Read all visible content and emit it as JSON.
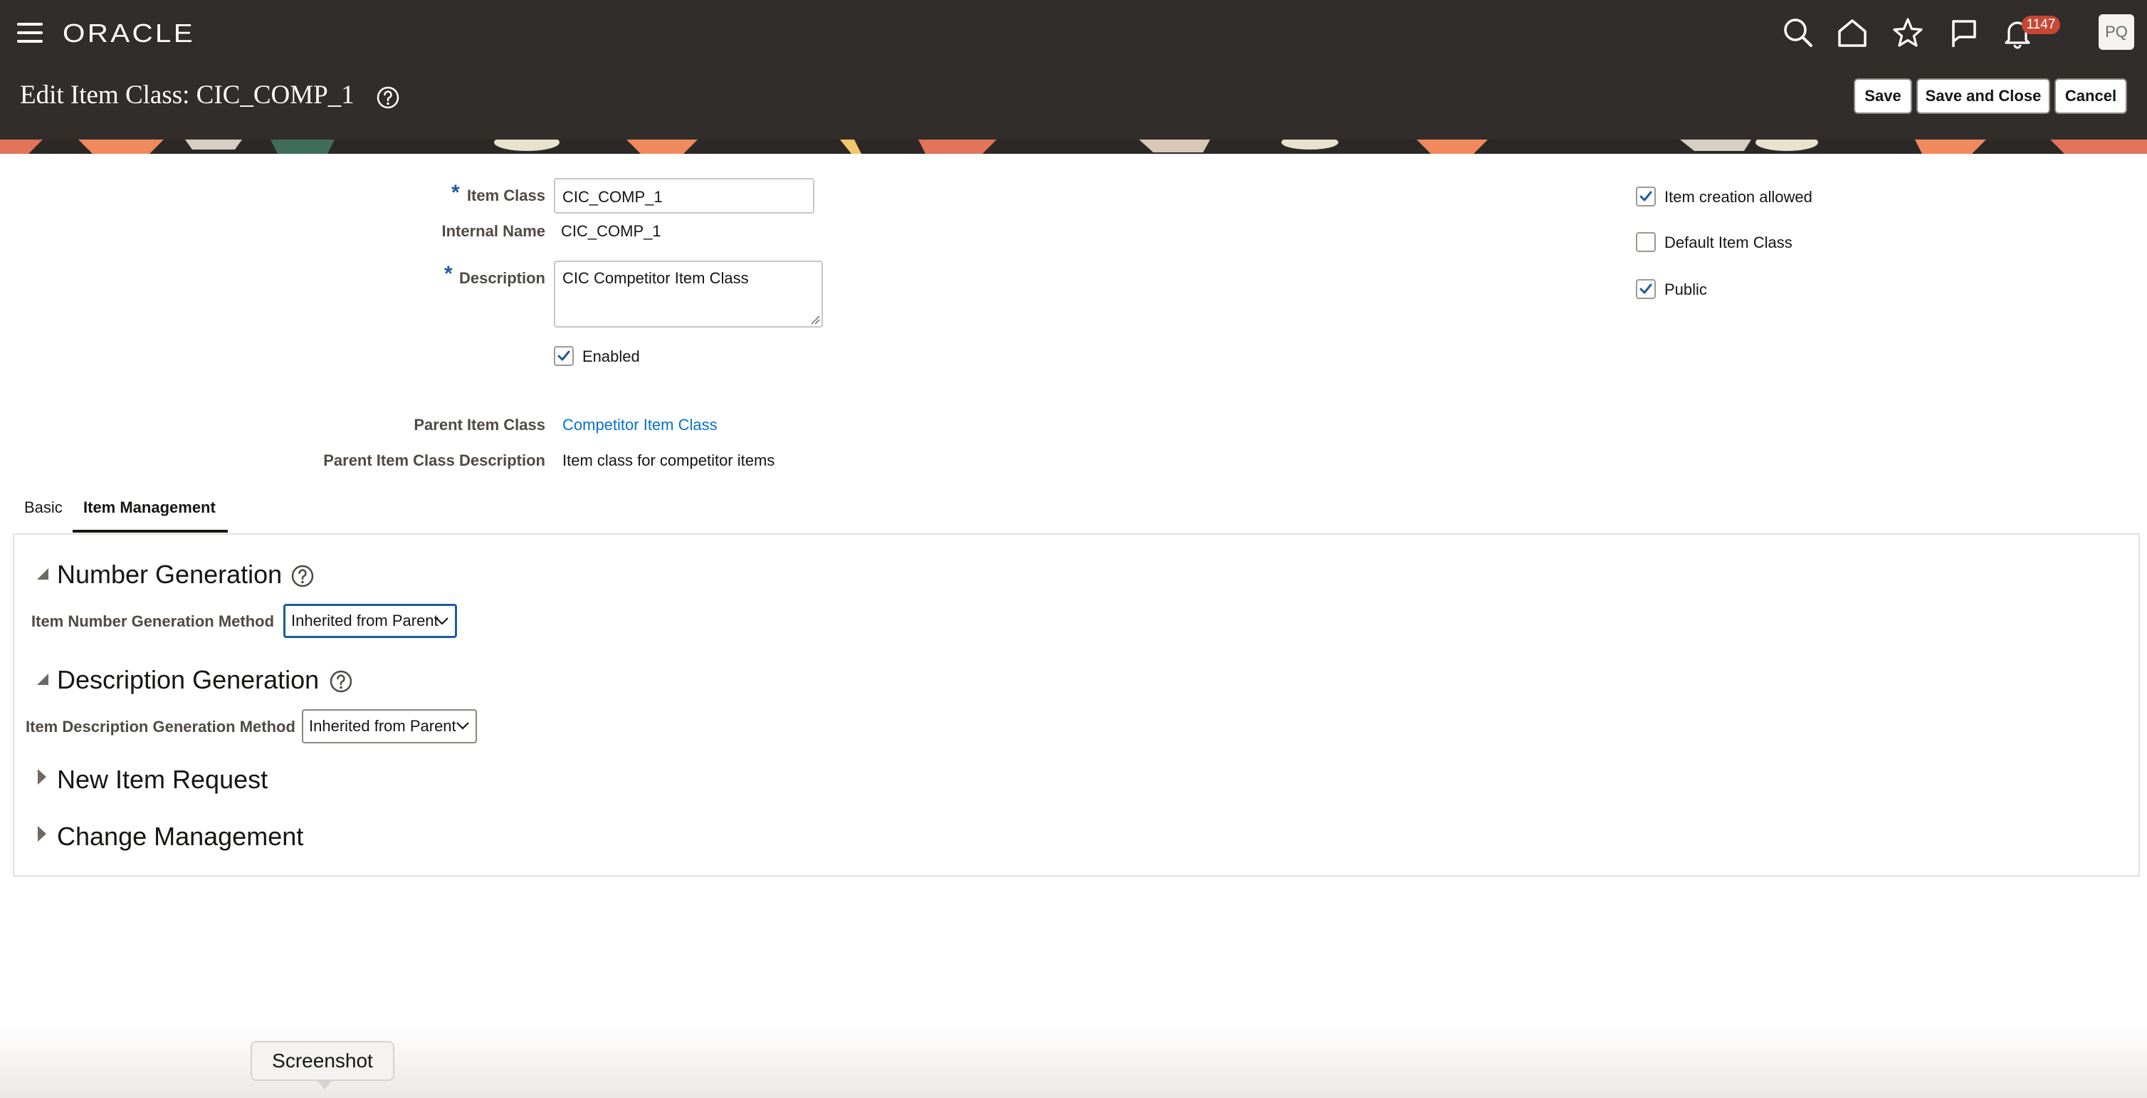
{
  "header": {
    "logo": "ORACLE",
    "notification_count": "1147",
    "avatar_initials": "PQ",
    "page_title": "Edit Item Class: CIC_COMP_1",
    "buttons": {
      "save": "Save",
      "save_and_close": "Save and Close",
      "cancel": "Cancel"
    }
  },
  "form": {
    "item_class_label": "Item Class",
    "item_class_value": "CIC_COMP_1",
    "internal_name_label": "Internal Name",
    "internal_name_value": "CIC_COMP_1",
    "description_label": "Description",
    "description_value": "CIC Competitor Item Class",
    "enabled_label": "Enabled",
    "enabled_checked": true,
    "parent_item_class_label": "Parent Item Class",
    "parent_item_class_value": "Competitor Item Class",
    "parent_desc_label": "Parent Item Class Description",
    "parent_desc_value": "Item class for competitor items",
    "required_marker": "*"
  },
  "options": [
    {
      "label": "Item creation allowed",
      "checked": true
    },
    {
      "label": "Default Item Class",
      "checked": false
    },
    {
      "label": "Public",
      "checked": true
    }
  ],
  "tabs": [
    {
      "label": "Basic",
      "selected": false
    },
    {
      "label": "Item Management",
      "selected": true
    }
  ],
  "sections": {
    "number_generation": {
      "title": "Number Generation",
      "expanded": true,
      "field_label": "Item Number Generation Method",
      "field_value": "Inherited from Parent"
    },
    "description_generation": {
      "title": "Description Generation",
      "expanded": true,
      "field_label": "Item Description Generation Method",
      "field_value": "Inherited from Parent"
    },
    "new_item_request": {
      "title": "New Item Request",
      "expanded": false
    },
    "change_management": {
      "title": "Change Management",
      "expanded": false
    }
  },
  "tooltip": {
    "text": "Screenshot"
  },
  "colors": {
    "header_bg": "#312d2a",
    "accent_blue": "#1e5ba0",
    "link_blue": "#0572ce",
    "badge_red": "#c74634"
  },
  "icons": [
    "hamburger-icon",
    "search-icon",
    "home-icon",
    "star-icon",
    "flag-icon",
    "bell-icon",
    "help-icon",
    "chevron-down-icon",
    "checkmark-icon",
    "expand-triangle-icon",
    "collapse-triangle-icon"
  ]
}
